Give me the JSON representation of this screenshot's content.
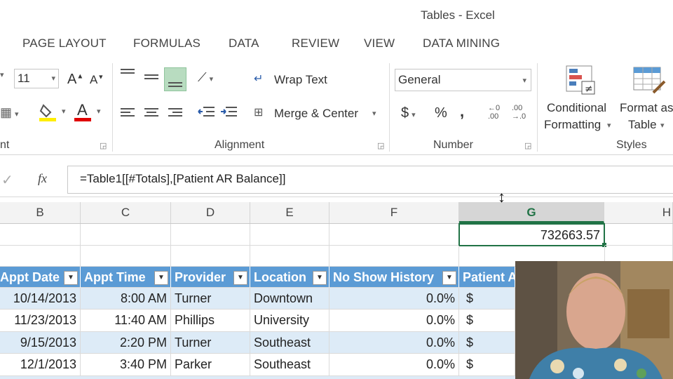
{
  "window": {
    "title": "Tables - Excel"
  },
  "ribbon_tabs": [
    "PAGE LAYOUT",
    "FORMULAS",
    "DATA",
    "REVIEW",
    "VIEW",
    "DATA MINING"
  ],
  "font": {
    "size": "11"
  },
  "alignment": {
    "wrap_text": "Wrap Text",
    "merge_center": "Merge & Center",
    "label": "Alignment"
  },
  "number": {
    "format": "General",
    "currency": "$",
    "percent": "%",
    "comma": ",",
    "label": "Number"
  },
  "styles": {
    "conditional_line1": "Conditional",
    "conditional_line2": "Formatting",
    "format_table_line1": "Format as",
    "format_table_line2": "Table",
    "label": "Styles"
  },
  "font_group_label_tail": "nt",
  "formula_bar": {
    "fx": "fx",
    "formula": "=Table1[[#Totals],[Patient AR Balance]]"
  },
  "columns": [
    "B",
    "C",
    "D",
    "E",
    "F",
    "G",
    "H"
  ],
  "active_cell_value": "732663.57",
  "table": {
    "headers": [
      "Appt Date",
      "Appt Time",
      "Provider",
      "Location",
      "No Show History",
      "Patient A"
    ],
    "rows": [
      [
        "10/14/2013",
        "8:00 AM",
        "Turner",
        "Downtown",
        "0.0%",
        "$"
      ],
      [
        "11/23/2013",
        "11:40 AM",
        "Phillips",
        "University",
        "0.0%",
        "$"
      ],
      [
        "9/15/2013",
        "2:20 PM",
        "Turner",
        "Southeast",
        "0.0%",
        "$"
      ],
      [
        "12/1/2013",
        "3:40 PM",
        "Parker",
        "Southeast",
        "0.0%",
        "$"
      ]
    ]
  },
  "colors": {
    "excel_green": "#217346",
    "table_header": "#5b9bd5",
    "band": "#ddebf7"
  }
}
